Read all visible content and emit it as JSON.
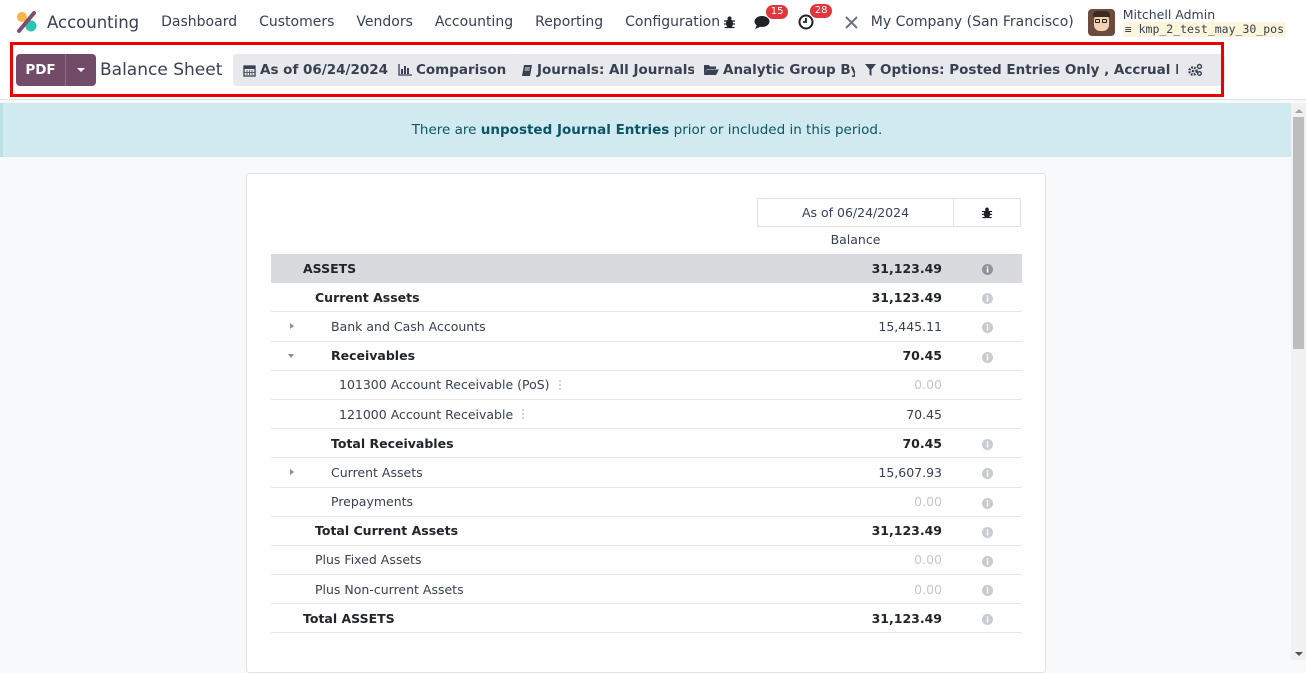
{
  "app": {
    "name": "Accounting",
    "nav": [
      "Dashboard",
      "Customers",
      "Vendors",
      "Accounting",
      "Reporting",
      "Configuration"
    ],
    "messages_count": "15",
    "activities_count": "28",
    "company": "My Company (San Francisco)",
    "user_name": "Mitchell Admin",
    "database": "kmp_2_test_may_30_pos"
  },
  "control": {
    "pdf_label": "PDF",
    "title": "Balance Sheet",
    "filters": {
      "date": "As of 06/24/2024",
      "comparison": "Comparison",
      "journals": "Journals: All Journals",
      "analytic": "Analytic Group By",
      "options": "Options: Posted Entries Only , Accrual Basis"
    }
  },
  "alert": {
    "prefix": "There are ",
    "link": "unposted Journal Entries",
    "suffix": " prior or included in this period."
  },
  "report": {
    "column_header": "As of 06/24/2024",
    "column_subheader": "Balance",
    "rows": [
      {
        "label": "ASSETS",
        "value": "31,123.49"
      },
      {
        "label": "Current Assets",
        "value": "31,123.49"
      },
      {
        "label": "Bank and Cash Accounts",
        "value": "15,445.11"
      },
      {
        "label": "Receivables",
        "value": "70.45"
      },
      {
        "label": "101300 Account Receivable (PoS)",
        "value": "0.00"
      },
      {
        "label": "121000 Account Receivable",
        "value": "70.45"
      },
      {
        "label": "Total Receivables",
        "value": "70.45"
      },
      {
        "label": "Current Assets",
        "value": "15,607.93"
      },
      {
        "label": "Prepayments",
        "value": "0.00"
      },
      {
        "label": "Total Current Assets",
        "value": "31,123.49"
      },
      {
        "label": "Plus Fixed Assets",
        "value": "0.00"
      },
      {
        "label": "Plus Non-current Assets",
        "value": "0.00"
      },
      {
        "label": "Total ASSETS",
        "value": "31,123.49"
      }
    ]
  },
  "colors": {
    "brand": "#714b67",
    "badge": "#e2363f",
    "alert_bg": "#d1eaef",
    "highlight": "#ee0000"
  }
}
